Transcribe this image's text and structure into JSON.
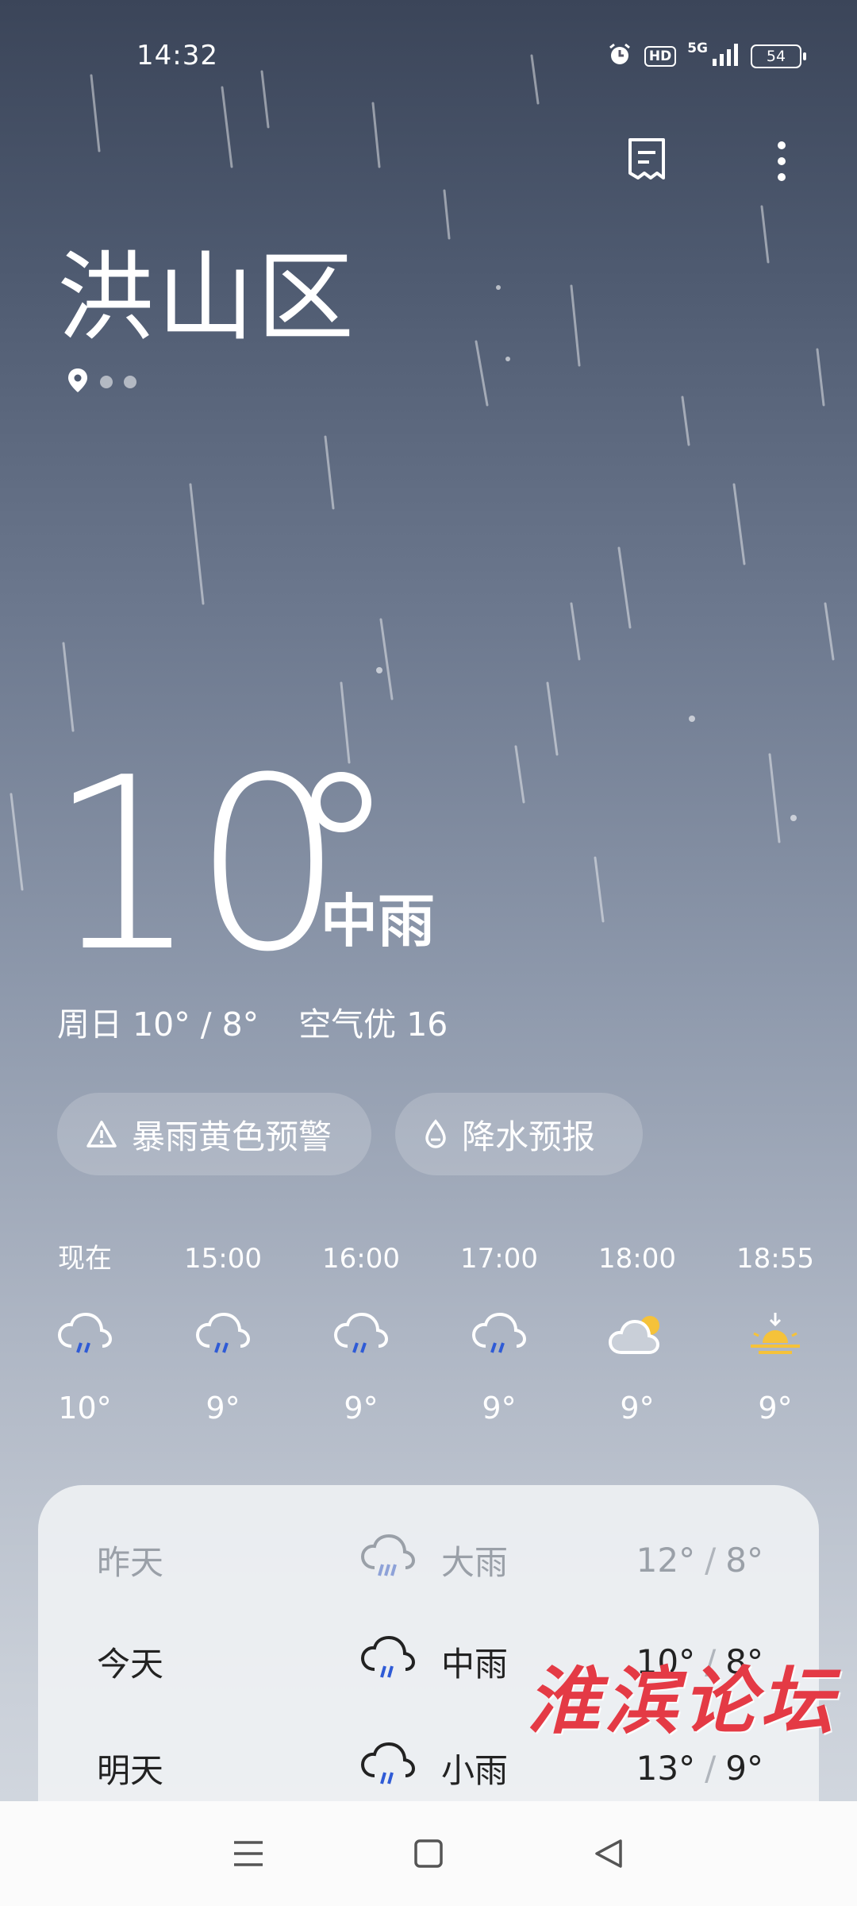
{
  "status_bar": {
    "time": "14:32",
    "network": "5G",
    "hd_badge": "HD",
    "battery": "54",
    "icons": [
      "alarm-icon",
      "hd-icon",
      "signal-icon",
      "battery-icon"
    ]
  },
  "header": {
    "city": "洪山区",
    "page_indicator_count": 3,
    "active_page": 0,
    "icons": [
      "report-icon",
      "more-icon",
      "location-icon"
    ]
  },
  "current": {
    "temperature": "10",
    "condition": "中雨",
    "day_label": "周日",
    "high_low": "10° / 8°",
    "air_quality": "空气优 16"
  },
  "chips": {
    "alert_label": "暴雨黄色预警",
    "precip_label": "降水预报"
  },
  "hourly": [
    {
      "time": "现在",
      "icon": "rain-icon",
      "temp": "10°"
    },
    {
      "time": "15:00",
      "icon": "rain-icon",
      "temp": "9°"
    },
    {
      "time": "16:00",
      "icon": "rain-icon",
      "temp": "9°"
    },
    {
      "time": "17:00",
      "icon": "rain-icon",
      "temp": "9°"
    },
    {
      "time": "18:00",
      "icon": "partly-cloudy-icon",
      "temp": "9°"
    },
    {
      "time": "18:55",
      "icon": "sunset-icon",
      "temp": "9°"
    }
  ],
  "daily": [
    {
      "day": "昨天",
      "condition": "大雨",
      "high": "12°",
      "low": "8°",
      "muted": true
    },
    {
      "day": "今天",
      "condition": "中雨",
      "high": "10°",
      "low": "8°",
      "muted": false
    },
    {
      "day": "明天",
      "condition": "小雨",
      "high": "13°",
      "low": "9°",
      "muted": false
    }
  ],
  "watermark": "淮滨论坛",
  "colors": {
    "sky_top": "#3b4559",
    "sky_bottom": "#d7dce3",
    "rain_drop_blue": "#2f5bd6",
    "sun_yellow": "#f5c23a",
    "watermark_red": "#e43a45"
  }
}
